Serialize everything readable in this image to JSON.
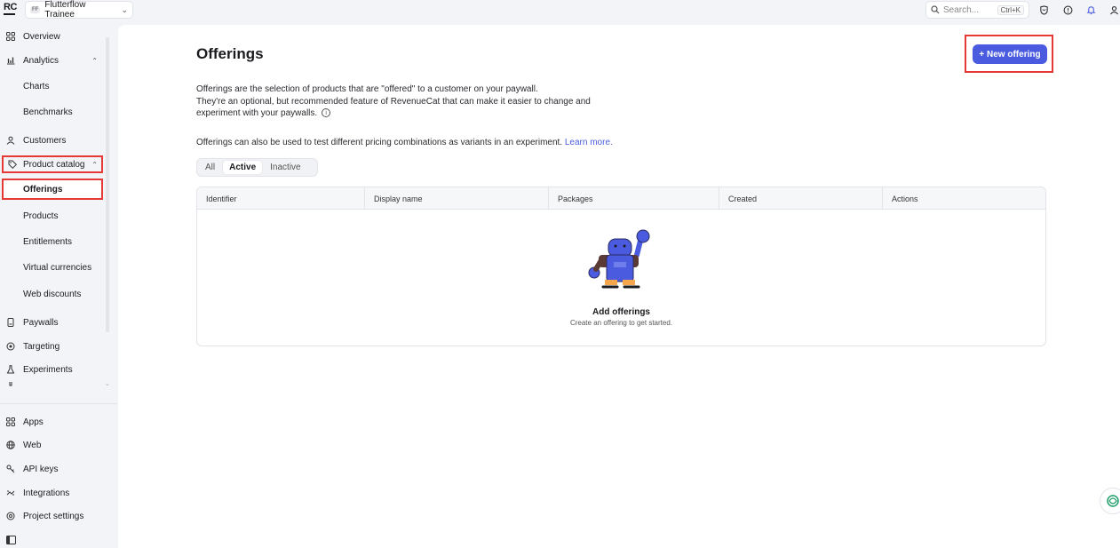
{
  "app": {
    "logo_text": "RC",
    "project_badge": "FF",
    "project_name": "Flutterflow Trainee"
  },
  "search": {
    "placeholder": "Search...",
    "shortcut": "Ctrl+K"
  },
  "top_icons": [
    "shield-icon",
    "help-icon",
    "bell-icon",
    "user-icon"
  ],
  "sidebar": {
    "items": [
      {
        "label": "Overview",
        "icon": "grid-icon"
      },
      {
        "label": "Analytics",
        "icon": "chart-icon"
      },
      {
        "label": "Charts"
      },
      {
        "label": "Benchmarks"
      },
      {
        "label": "Customers",
        "icon": "user-icon"
      },
      {
        "label": "Product catalog",
        "icon": "tag-icon"
      },
      {
        "label": "Offerings"
      },
      {
        "label": "Products"
      },
      {
        "label": "Entitlements"
      },
      {
        "label": "Virtual currencies"
      },
      {
        "label": "Web discounts"
      },
      {
        "label": "Paywalls",
        "icon": "phone-icon"
      },
      {
        "label": "Targeting",
        "icon": "target-icon"
      },
      {
        "label": "Experiments",
        "icon": "flask-icon"
      }
    ],
    "bottom_items": [
      {
        "label": "Apps",
        "icon": "apps-icon"
      },
      {
        "label": "Web",
        "icon": "globe-icon"
      },
      {
        "label": "API keys",
        "icon": "key-icon"
      },
      {
        "label": "Integrations",
        "icon": "integrations-icon"
      },
      {
        "label": "Project settings",
        "icon": "settings-icon"
      }
    ]
  },
  "main": {
    "title": "Offerings",
    "new_button": "+ New offering",
    "desc_line1": "Offerings are the selection of products that are \"offered\" to a customer on your paywall.",
    "desc_line2": "They're an optional, but recommended feature of RevenueCat that can make it easier to change and",
    "desc_line3": "experiment with your paywalls.",
    "desc2": "Offerings can also be used to test different pricing combinations as variants in an experiment.",
    "learn_more": "Learn more.",
    "tabs": [
      "All",
      "Active",
      "Inactive"
    ],
    "active_tab": "Active",
    "table": {
      "columns": [
        "Identifier",
        "Display name",
        "Packages",
        "Created",
        "Actions"
      ],
      "empty_title": "Add offerings",
      "empty_sub": "Create an offering to get started."
    }
  },
  "colors": {
    "accent": "#4a5be0",
    "highlight": "#e53935",
    "sidebar_bg": "#f3f4f8"
  }
}
